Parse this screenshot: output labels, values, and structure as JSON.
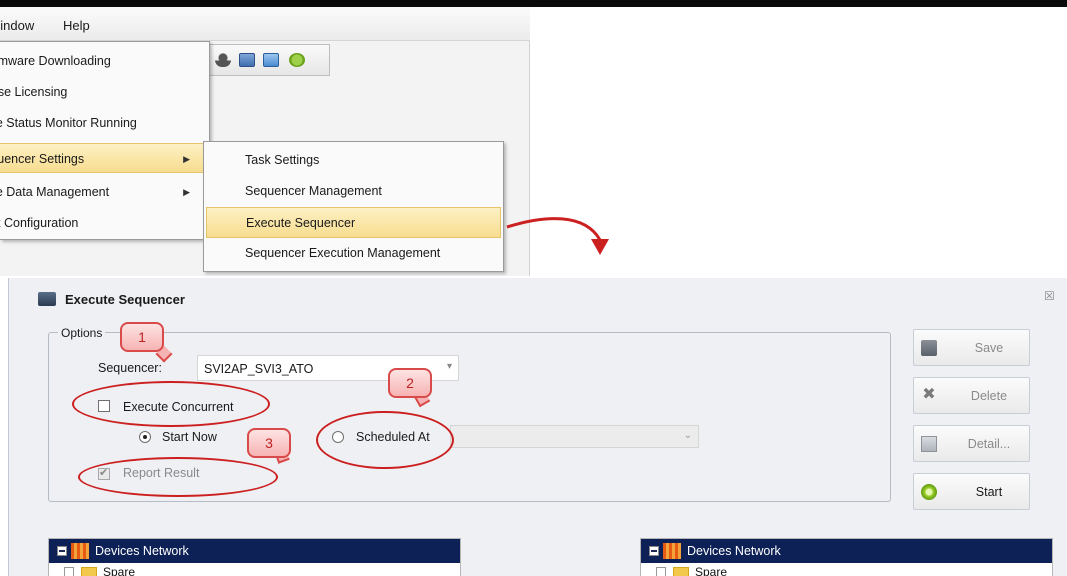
{
  "menubar": {
    "window_label": "Window",
    "help_label": "Help"
  },
  "menu": {
    "items": [
      {
        "label": "Firmware Downloading"
      },
      {
        "label": "License Licensing"
      },
      {
        "label": "Remote Status Monitor Running"
      },
      {
        "label": "Sequencer Settings",
        "submenu": true,
        "highlighted": true
      },
      {
        "label": "Remote Data Management",
        "submenu": true
      },
      {
        "label": "Report Configuration"
      }
    ]
  },
  "submenu": {
    "items": [
      {
        "label": "Task Settings"
      },
      {
        "label": "Sequencer Management"
      },
      {
        "label": "Execute Sequencer",
        "highlighted": true
      },
      {
        "label": "Sequencer Execution Management"
      }
    ]
  },
  "dialog": {
    "title": "Execute Sequencer",
    "close_glyph": "☒",
    "options_label": "Options",
    "sequencer_label": "Sequencer:",
    "sequencer_value": "SVI2AP_SVI3_ATO",
    "execute_concurrent_label": "Execute Concurrent",
    "execute_concurrent_checked": false,
    "start_now_label": "Start Now",
    "start_now_selected": true,
    "scheduled_at_label": "Scheduled At",
    "report_result_label": "Report Result",
    "report_result_checked": true,
    "report_result_enabled": false
  },
  "callouts": [
    "1",
    "2",
    "3"
  ],
  "side_buttons": {
    "save": {
      "label": "Save",
      "icon": "save-icon",
      "enabled": false
    },
    "delete": {
      "label": "Delete",
      "icon": "delete-icon",
      "enabled": false
    },
    "detail": {
      "label": "Detail...",
      "icon": "detail-icon",
      "enabled": false
    },
    "start": {
      "label": "Start",
      "icon": "play-icon",
      "enabled": true
    }
  },
  "trees": {
    "left": {
      "header": "Devices Network",
      "first_child": "Spare"
    },
    "right": {
      "header": "Devices Network",
      "first_child": "Spare"
    }
  },
  "colors": {
    "highlight": "#f7dd8f",
    "tree_header": "#0d2157",
    "annotation": "#cc1f1f"
  }
}
